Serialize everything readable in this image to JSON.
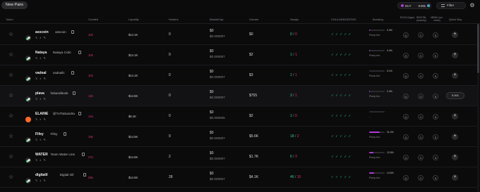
{
  "toolbar": {
    "new_pairs_label": "New Pairs",
    "quick_buy_label": "BUY",
    "quick_buy_amount": "0.001",
    "filter_label": "Filter",
    "settings_icon": "gear-icon"
  },
  "headers": {
    "token": "Token",
    "created": "Created",
    "liquidity": "Liquidity",
    "holders": "Holders",
    "marketcap": "MarketCap",
    "volume": "Volume",
    "swaps": "Swaps",
    "checks": "CHL/LIUDDONTHD",
    "bonding": "Bonding",
    "col_a": "ECHO (hype)",
    "col_b": "SENTINL (security)",
    "col_c": "MEMU (on-chain)",
    "quick_buy": "Quick Buy"
  },
  "rows": [
    {
      "symbol": "asscoin",
      "name": "asscoin",
      "created": "10s",
      "liquidity": "$14.1K",
      "holders": "0",
      "mc": "$0",
      "mc_sub": "$0.000007",
      "volume": "$0",
      "buys": "0",
      "sells": "0",
      "checks": "✓ ✓ ✓ ✓ ✓",
      "bond_pct": "0.4%",
      "bond_value": 0.004,
      "bond_label": "Pump fun",
      "quick": "+",
      "image": "pill"
    },
    {
      "symbol": "Nataya",
      "name": "Nataya Colic",
      "created": "10s",
      "liquidity": "$14.1K",
      "holders": "0",
      "mc": "$0",
      "mc_sub": "$0.000007",
      "volume": "$2",
      "buys": "1",
      "sells": "1",
      "checks": "✓ ✓ ✓ ✓ ✓",
      "bond_pct": "0.4%",
      "bond_value": 0.004,
      "bond_label": "Pump fun",
      "quick": "+",
      "image": "pill"
    },
    {
      "symbol": "vadeal",
      "name": "vadeallc",
      "created": "10s",
      "liquidity": "$14.1K",
      "holders": "0",
      "mc": "$0",
      "mc_sub": "$0.000007",
      "volume": "$3",
      "buys": "1",
      "sells": "1",
      "checks": "✓ ✓ ✓ ✓ ✓",
      "bond_pct": "0.1%",
      "bond_value": 0.001,
      "bond_label": "Pump fun",
      "quick": "+",
      "image": "pill"
    },
    {
      "symbol": "plava",
      "name": "hdsandbook",
      "created": "13s",
      "liquidity": "$14.5K",
      "holders": "0",
      "mc": "$0",
      "mc_sub": "$0.000007",
      "volume": "$755",
      "buys": "3",
      "sells": "1",
      "checks": "✓ ✓ ✓ ✓ ✓",
      "bond_pct": "2.4%",
      "bond_value": 0.024,
      "bond_label": "Pump fun",
      "quick": "0.001",
      "image": "pill"
    },
    {
      "symbol": "ELAINE",
      "name": "@TuTlaSandra",
      "created": "14s",
      "liquidity": "$6.1K",
      "holders": "0",
      "mc": "$0",
      "mc_sub": "$0.000005",
      "volume": "$2",
      "buys": "1",
      "sells": "0",
      "checks": "✓ ✓ ✓ ✓ ✓",
      "bond_pct": "",
      "bond_value": 0,
      "bond_label": "-",
      "quick": "+",
      "image": "face"
    },
    {
      "symbol": "Fifey",
      "name": "Fifey",
      "created": "19s",
      "liquidity": "$14.5K",
      "holders": "9",
      "mc": "$0",
      "mc_sub": "$0.000007",
      "volume": "$5.6K",
      "buys": "18",
      "sells": "2",
      "checks": "✓ ✓ ✓ ✓ ✓",
      "bond_pct": "31.2%",
      "bond_value": 0.312,
      "bond_label": "Pump fun",
      "quick": "+",
      "image": "pill"
    },
    {
      "symbol": "WATER",
      "name": "Team Water Line",
      "created": "27s",
      "liquidity": "$14.5K",
      "holders": "2",
      "mc": "$0",
      "mc_sub": "$0.000007",
      "volume": "$1.7K",
      "buys": "6",
      "sells": "3",
      "checks": "✓ ✓ ✓ ✓ ✓",
      "bond_pct": "12.6%",
      "bond_value": 0.126,
      "bond_label": "Pump fun",
      "quick": "+",
      "image": "pill"
    },
    {
      "symbol": "digitalil",
      "name": "Digital Oil",
      "created": "28s",
      "liquidity": "$14.5K",
      "holders": "28",
      "mc": "$0",
      "mc_sub": "$0.000007",
      "volume": "$4.1K",
      "buys": "46",
      "sells": "15",
      "checks": "✓ ✓ ✓ ✓ ✓",
      "bond_pct": "14.6%",
      "bond_value": 0.146,
      "bond_label": "Pump fun",
      "quick": "+",
      "image": "pill"
    }
  ],
  "colors": {
    "accent": "#b13ad6",
    "buy": "#2fd08a",
    "sell": "#e0325a",
    "created": "#e0327a"
  }
}
